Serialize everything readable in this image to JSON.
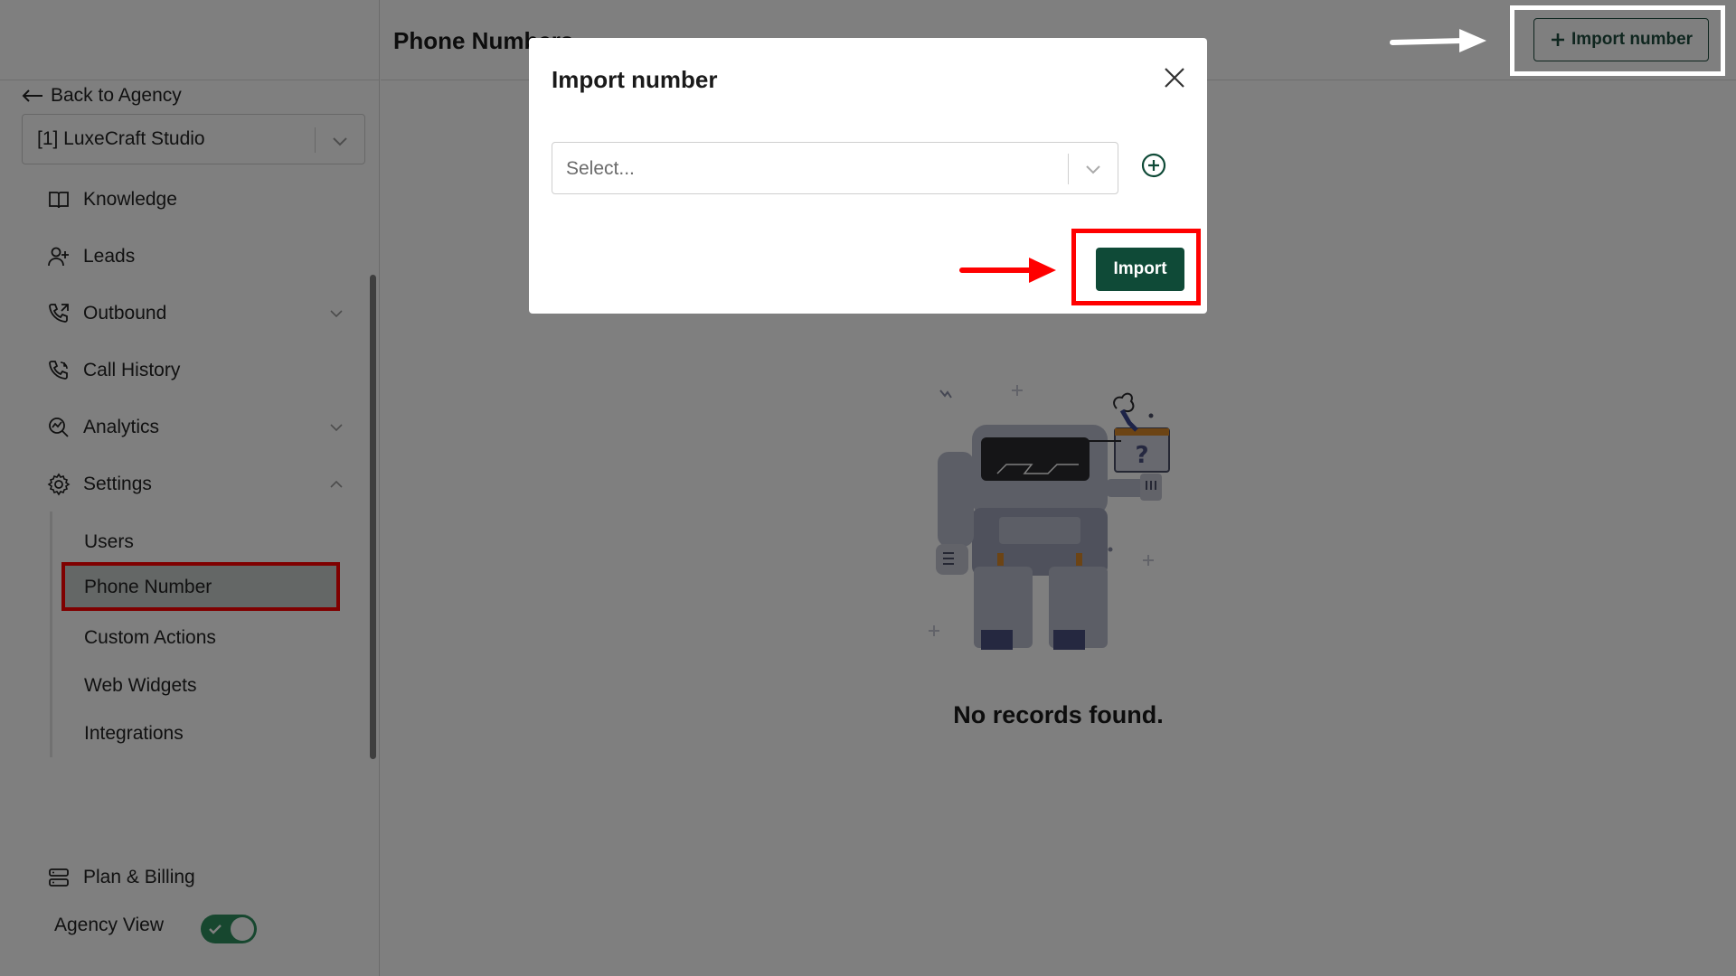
{
  "sidebar": {
    "back_label": "Back to Agency",
    "agency_selected": "[1] LuxeCraft Studio",
    "items": [
      {
        "label": "Knowledge",
        "icon": "book-icon"
      },
      {
        "label": "Leads",
        "icon": "user-plus-icon"
      },
      {
        "label": "Outbound",
        "icon": "phone-outgoing-icon"
      },
      {
        "label": "Call History",
        "icon": "phone-history-icon"
      },
      {
        "label": "Analytics",
        "icon": "analytics-icon"
      },
      {
        "label": "Settings",
        "icon": "gear-icon"
      }
    ],
    "settings_sub": [
      "Users",
      "Phone Number",
      "Custom Actions",
      "Web Widgets",
      "Integrations"
    ],
    "billing_label": "Plan & Billing",
    "agency_view_label": "Agency View",
    "agency_view_on": true
  },
  "main": {
    "page_title": "Phone Numbers",
    "import_button_label": "Import number",
    "empty_message": "No records found."
  },
  "modal": {
    "title": "Import number",
    "select_placeholder": "Select...",
    "import_label": "Import"
  },
  "colors": {
    "brand_dark_green": "#0f4a37",
    "toggle_green": "#2f8f5f",
    "highlight_red": "#ff0000",
    "overlay": "rgba(0,0,0,0.5)"
  }
}
